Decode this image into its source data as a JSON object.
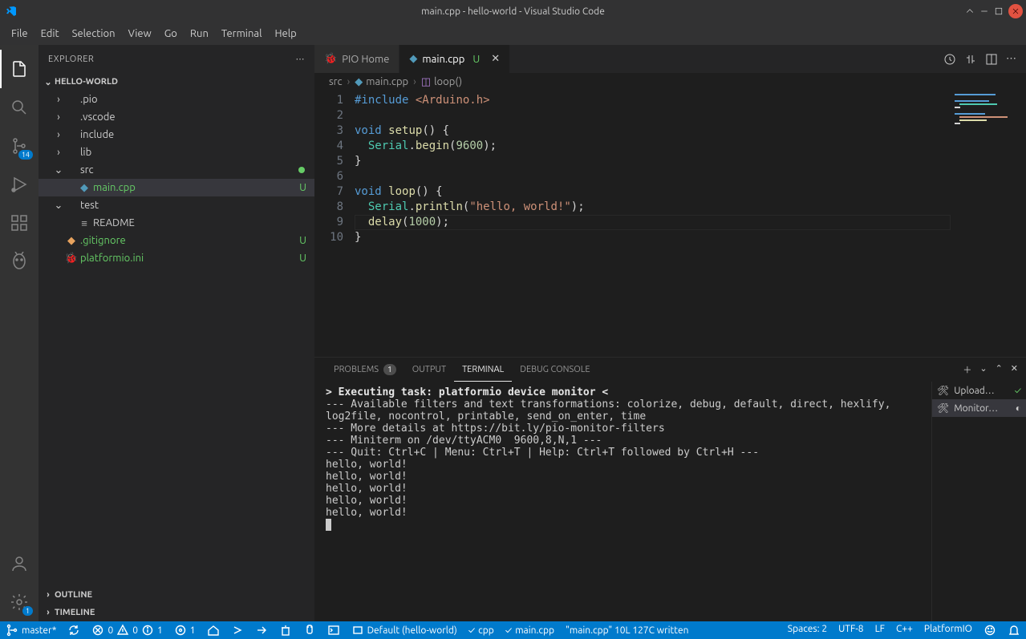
{
  "title": "main.cpp - hello-world - Visual Studio Code",
  "menu": [
    "File",
    "Edit",
    "Selection",
    "View",
    "Go",
    "Run",
    "Terminal",
    "Help"
  ],
  "activity": {
    "scm_badge": "14",
    "settings_badge": "1"
  },
  "sidebar": {
    "title": "EXPLORER",
    "project": "HELLO-WORLD",
    "items": [
      {
        "name": ".pio",
        "type": "folder",
        "depth": 1,
        "expanded": false
      },
      {
        "name": ".vscode",
        "type": "folder",
        "depth": 1,
        "expanded": false
      },
      {
        "name": "include",
        "type": "folder",
        "depth": 1,
        "expanded": false
      },
      {
        "name": "lib",
        "type": "folder",
        "depth": 1,
        "expanded": false
      },
      {
        "name": "src",
        "type": "folder",
        "depth": 1,
        "expanded": true,
        "modified": true
      },
      {
        "name": "main.cpp",
        "type": "file",
        "depth": 2,
        "selected": true,
        "status": "U",
        "icon": "cpp"
      },
      {
        "name": "test",
        "type": "folder",
        "depth": 1,
        "expanded": true
      },
      {
        "name": "README",
        "type": "file",
        "depth": 2,
        "icon": "doc"
      },
      {
        "name": ".gitignore",
        "type": "file",
        "depth": 1,
        "status": "U",
        "icon": "git"
      },
      {
        "name": "platformio.ini",
        "type": "file",
        "depth": 1,
        "status": "U",
        "icon": "pio"
      }
    ],
    "sections": [
      "OUTLINE",
      "TIMELINE"
    ]
  },
  "tabs": [
    {
      "label": "PIO Home",
      "kind": "pio"
    },
    {
      "label": "main.cpp",
      "kind": "cpp",
      "mod": "U",
      "active": true
    }
  ],
  "breadcrumbs": {
    "parts": [
      "src",
      "main.cpp",
      "loop()"
    ]
  },
  "editor": {
    "line_count": 10,
    "current_line": 9
  },
  "chart_data": {
    "type": "table",
    "title": "main.cpp source",
    "lines": [
      "#include <Arduino.h>",
      "",
      "void setup() {",
      "  Serial.begin(9600);",
      "}",
      "",
      "void loop() {",
      "  Serial.println(\"hello, world!\");",
      "  delay(1000);",
      "}"
    ]
  },
  "panel": {
    "tabs": [
      {
        "label": "PROBLEMS",
        "badge": "1"
      },
      {
        "label": "OUTPUT"
      },
      {
        "label": "TERMINAL",
        "active": true
      },
      {
        "label": "DEBUG CONSOLE"
      }
    ],
    "terminals": [
      {
        "label": "Upload…",
        "icon": "tool",
        "done": true
      },
      {
        "label": "Monitor…",
        "icon": "tool",
        "active": true,
        "spinner": true
      }
    ],
    "output": [
      {
        "bold": true,
        "text": "> Executing task: platformio device monitor <"
      },
      {
        "text": ""
      },
      {
        "text": "--- Available filters and text transformations: colorize, debug, default, direct, hexlify, log2file, nocontrol, printable, send_on_enter, time"
      },
      {
        "text": "--- More details at https://bit.ly/pio-monitor-filters"
      },
      {
        "text": "--- Miniterm on /dev/ttyACM0  9600,8,N,1 ---"
      },
      {
        "text": "--- Quit: Ctrl+C | Menu: Ctrl+T | Help: Ctrl+T followed by Ctrl+H ---"
      },
      {
        "text": "hello, world!"
      },
      {
        "text": "hello, world!"
      },
      {
        "text": "hello, world!"
      },
      {
        "text": "hello, world!"
      },
      {
        "text": "hello, world!"
      }
    ]
  },
  "status": {
    "branch": "master*",
    "errors": "0",
    "warnings": "0",
    "info": "1",
    "ports": "1",
    "env": "Default (hello-world)",
    "check_cpp": "cpp",
    "check_file": "main.cpp",
    "written": "\"main.cpp\" 10L 127C written",
    "spaces": "Spaces: 2",
    "encoding": "UTF-8",
    "eol": "LF",
    "lang": "C++",
    "platform": "PlatformIO"
  }
}
